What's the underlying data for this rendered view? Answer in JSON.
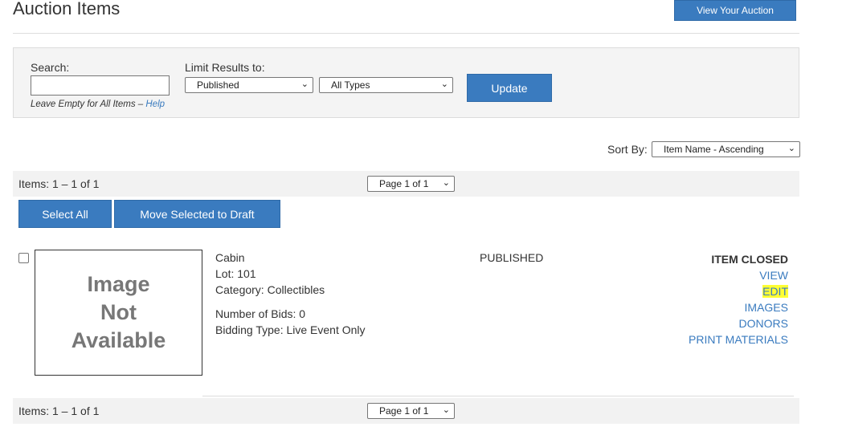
{
  "page": {
    "title": "Auction Items",
    "view_auction_label": "View Your Auction"
  },
  "filters": {
    "search_label": "Search:",
    "search_value": "",
    "limit_label": "Limit Results to:",
    "status_selected": "Published",
    "type_selected": "All Types",
    "help_prefix": "Leave Empty for All Items – ",
    "help_link": "Help",
    "update_label": "Update"
  },
  "sort": {
    "label": "Sort By:",
    "selected": "Item Name - Ascending"
  },
  "pager": {
    "count_text": "Items: 1 – 1 of 1",
    "page_selected": "Page 1 of 1"
  },
  "bulk": {
    "select_all_label": "Select All",
    "move_draft_label": "Move Selected to Draft"
  },
  "items": [
    {
      "image_placeholder": "Image\nNot\nAvailable",
      "name": "Cabin",
      "lot": "Lot: 101",
      "category": "Category: Collectibles",
      "bids": "Number of Bids: 0",
      "bidding_type": "Bidding Type: Live Event Only",
      "status": "PUBLISHED",
      "state": "ITEM CLOSED",
      "actions": {
        "view": "VIEW",
        "edit": "EDIT",
        "images": "IMAGES",
        "donors": "DONORS",
        "print": "PRINT MATERIALS"
      }
    }
  ],
  "colors": {
    "accent": "#3a7bbf",
    "highlight": "#ffff33"
  }
}
